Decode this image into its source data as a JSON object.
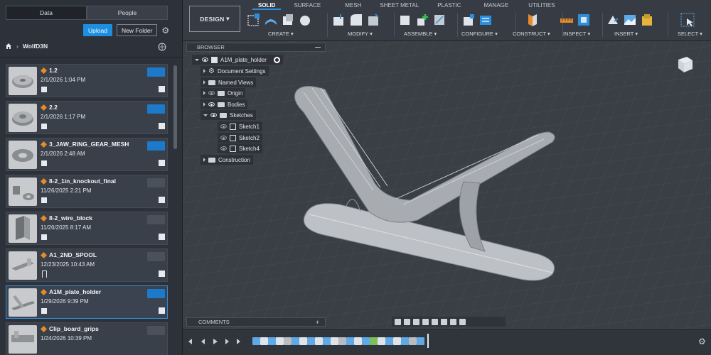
{
  "left_panel": {
    "tabs": [
      "Data",
      "People"
    ],
    "upload_label": "Upload",
    "new_folder_label": "New Folder",
    "breadcrumb": "WolfD3N",
    "files": [
      {
        "name": "1.2",
        "date": "2/1/2026 1:04 PM",
        "status": "cube"
      },
      {
        "name": "2.2",
        "date": "2/1/2026 1:17 PM",
        "status": "cube"
      },
      {
        "name": "3_JAW_RING_GEAR_MESH",
        "date": "2/1/2026 2:48 AM",
        "status": "cube"
      },
      {
        "name": "8-2_1in_knockout_final",
        "date": "11/26/2025 2:21 PM",
        "status": "cube"
      },
      {
        "name": "8-2_wire_block",
        "date": "11/26/2025 8:17 AM",
        "status": "cube"
      },
      {
        "name": "A1_2ND_SPOOL",
        "date": "12/23/2025 10:43 AM",
        "status": "flag"
      },
      {
        "name": "A1M_plate_holder",
        "date": "1/29/2026 9:39 PM",
        "status": "cube"
      },
      {
        "name": "Clip_board_grips",
        "date": "1/24/2026 10:39 PM",
        "status": "cube"
      }
    ]
  },
  "toolbar": {
    "workspace": "DESIGN",
    "tabs": [
      "SOLID",
      "SURFACE",
      "MESH",
      "SHEET METAL",
      "PLASTIC",
      "MANAGE",
      "UTILITIES"
    ],
    "groups": [
      "CREATE",
      "MODIFY",
      "ASSEMBLE",
      "CONFIGURE",
      "CONSTRUCT",
      "INSPECT",
      "INSERT",
      "SELECT"
    ]
  },
  "browser": {
    "title": "BROWSER",
    "root": "A1M_plate_holder",
    "items": [
      "Document Settings",
      "Named Views",
      "Origin",
      "Bodies",
      "Sketches",
      "Sketch1",
      "Sketch2",
      "Sketch4",
      "Construction"
    ]
  },
  "comments_label": "COMMENTS",
  "colors": {
    "accent": "#1d8fe0",
    "file_icon": "#e78a2a"
  }
}
